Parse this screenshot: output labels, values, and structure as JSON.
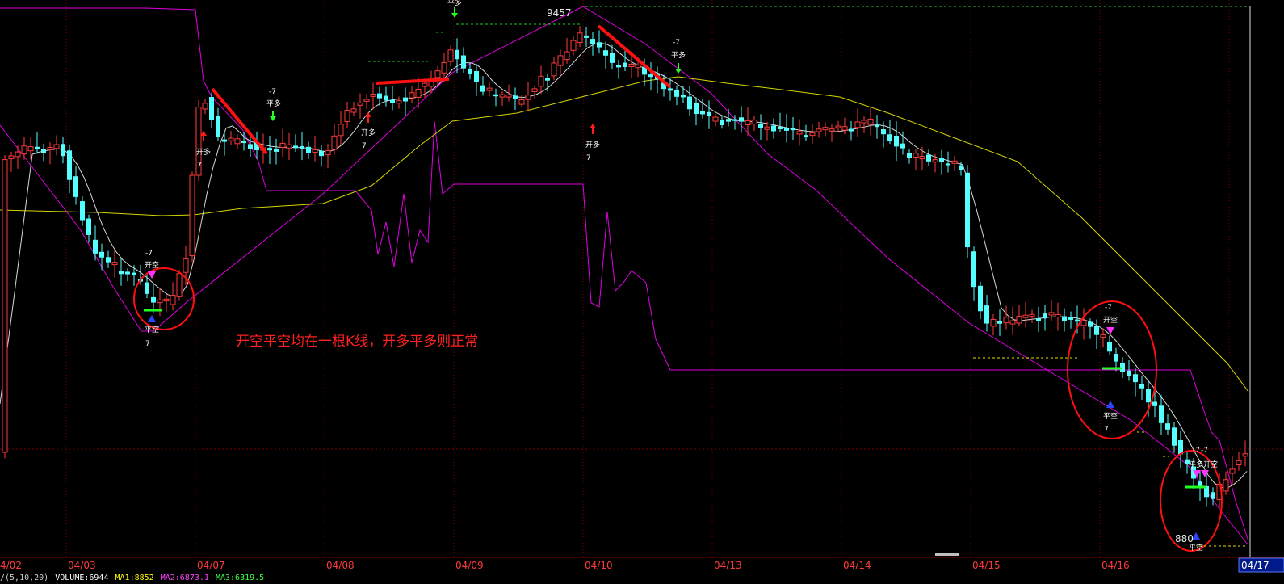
{
  "dates": [
    "4/02",
    "04/03",
    "04/07",
    "04/08",
    "04/09",
    "04/10",
    "04/13",
    "04/14",
    "04/15",
    "04/16",
    "04/17"
  ],
  "annotation": "开空平空均在一根K线，开多平多则正常",
  "price_labels": {
    "high": "9457",
    "low": "880"
  },
  "signals": {
    "open_long": "开多",
    "close_long": "平多",
    "open_short": "开空",
    "close_short": "平空",
    "close_long_open_short": "平多开空",
    "qty_pos": "7",
    "qty_neg": "-7"
  },
  "status": {
    "prefix": "/(5,10,20)",
    "vol": "VOLUME:6944",
    "ma1": "MA1:8852",
    "ma2": "MA2:6873.1",
    "ma3": "MA3:6319.5"
  },
  "colors": {
    "up": "#ff3b3b",
    "down": "#54ffff",
    "ma_short": "#d8d8d8",
    "ma_long": "#d6d600",
    "envelope": "#e000e0",
    "signal_up": "#ff1a1a",
    "signal_down": "#22ff22",
    "grid": "#7a0000",
    "annotation": "#ff2020"
  }
}
